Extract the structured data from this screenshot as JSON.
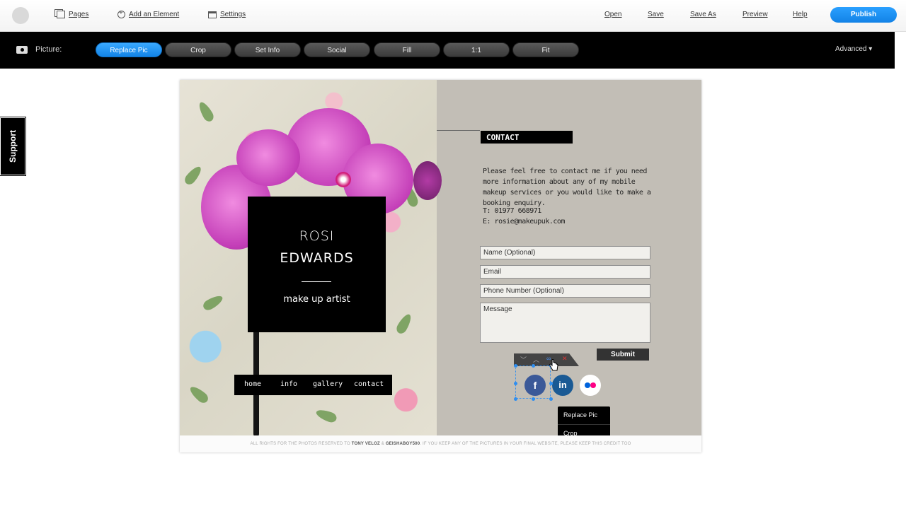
{
  "topbar": {
    "pages": "Pages",
    "add_element": "Add an Element",
    "settings": "Settings",
    "open": "Open",
    "save": "Save",
    "save_as": "Save As",
    "preview": "Preview",
    "help": "Help",
    "publish": "Publish"
  },
  "picture_toolbar": {
    "label": "Picture:",
    "buttons": [
      "Replace Pic",
      "Crop",
      "Set Info",
      "Social",
      "Fill",
      "1:1",
      "Fit"
    ],
    "active": "Replace Pic",
    "advanced": "Advanced ▾"
  },
  "support_tab": "Support",
  "site": {
    "name_line1": "ROSI",
    "name_line2": "EDWARDS",
    "tagline": "make up artist",
    "nav": [
      "home",
      "info",
      "gallery",
      "contact"
    ],
    "contact": {
      "title": "CONTACT",
      "intro": "Please feel free to contact me if you need more information about any of my mobile makeup services or you would like to make a booking enquiry.",
      "phone": "T: 01977 668971",
      "email": "E: rosie@makeupuk.com"
    },
    "form": {
      "name_placeholder": "Name (Optional)",
      "email_placeholder": "Email",
      "phone_placeholder": "Phone Number (Optional)",
      "message_placeholder": "Message",
      "submit": "Submit"
    },
    "social": {
      "facebook": "f",
      "linkedin": "in"
    },
    "context_menu": [
      "Replace Pic",
      "Crop"
    ],
    "footer_prefix": "ALL RIGHTS FOR THE PHOTOS RESERVED TO",
    "footer_name1": "TONY VELOZ",
    "footer_amp": "&",
    "footer_name2": "GEISHABOY500",
    "footer_suffix": ". IF YOU KEEP ANY OF THE PICTURES IN YOUR FINAL WEBSITE, PLEASE KEEP THIS CREDIT TOO"
  },
  "colors": {
    "accent_blue": "#1a8cf0",
    "site_bg": "#c2beb6",
    "facebook": "#3b5998",
    "linkedin": "#1a5a94",
    "flickr_blue": "#0063dc",
    "flickr_pink": "#ff0084"
  }
}
